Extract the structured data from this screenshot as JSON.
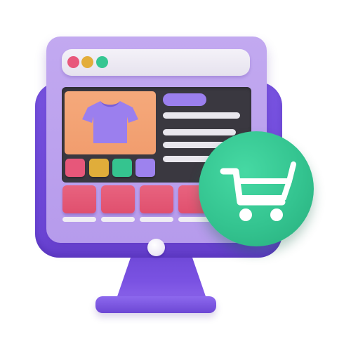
{
  "illustration": {
    "subject": "",
    "colors": {
      "monitor_front": "#b69bec",
      "monitor_back": "#6b45d6",
      "content_panel": "#3a3840",
      "product_card": "#f19d6e",
      "tshirt": "#9b7fee",
      "cart_badge": "#34c490",
      "tile": "#e0506e"
    },
    "window_controls": [
      "red",
      "yellow",
      "green"
    ],
    "color_swatches": [
      "#e7577a",
      "#e0ad3a",
      "#35c48f",
      "#9d82ee"
    ],
    "icons": [
      "tshirt-icon",
      "shopping-cart-icon"
    ]
  }
}
